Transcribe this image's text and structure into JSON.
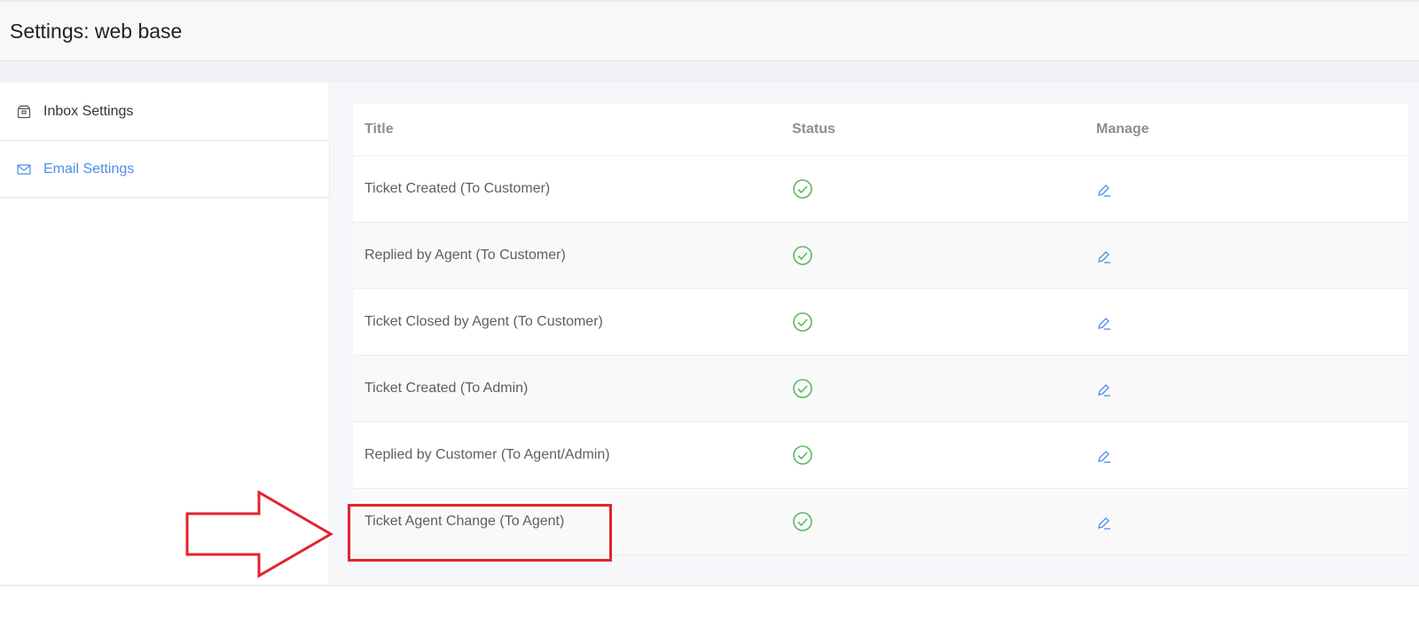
{
  "header": {
    "title": "Settings: web base"
  },
  "sidebar": {
    "items": [
      {
        "label": "Inbox Settings",
        "icon": "box-icon",
        "active": false
      },
      {
        "label": "Email Settings",
        "icon": "mail-icon",
        "active": true
      }
    ]
  },
  "table": {
    "columns": {
      "title": "Title",
      "status": "Status",
      "manage": "Manage"
    },
    "rows": [
      {
        "title": "Ticket Created (To Customer)",
        "status": "enabled"
      },
      {
        "title": "Replied by Agent (To Customer)",
        "status": "enabled"
      },
      {
        "title": "Ticket Closed by Agent (To Customer)",
        "status": "enabled"
      },
      {
        "title": "Ticket Created (To Admin)",
        "status": "enabled"
      },
      {
        "title": "Replied by Customer (To Agent/Admin)",
        "status": "enabled"
      },
      {
        "title": "Ticket Agent Change (To Agent)",
        "status": "enabled"
      }
    ]
  },
  "colors": {
    "accent": "#4a8ee8",
    "status_ok": "#5cb85c",
    "annotation": "#e3232b"
  }
}
